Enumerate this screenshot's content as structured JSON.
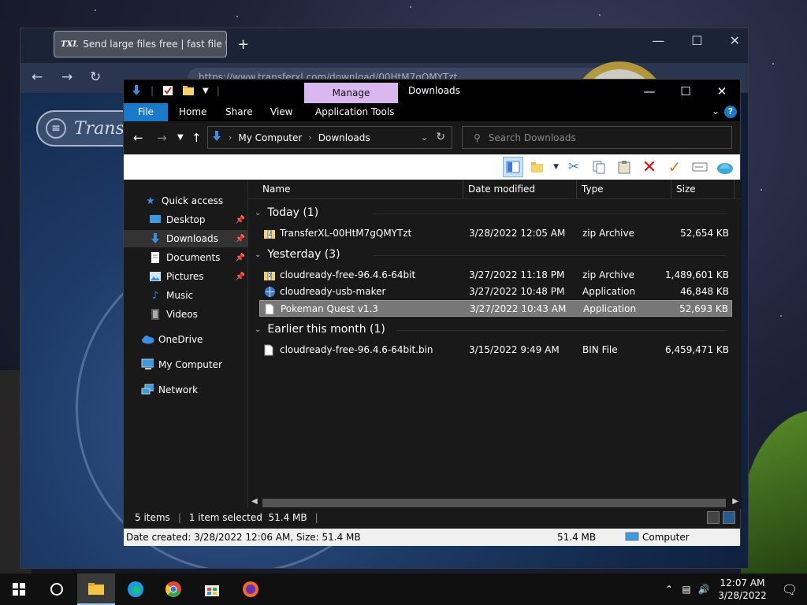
{
  "browser": {
    "tab_title": "Send large files free | fast file tra",
    "tab_favicon": "TXL",
    "url": "https://www.transferxl.com/download/00HtM7gQMYTzt",
    "logo_text": "Transfe"
  },
  "explorer": {
    "title": "Downloads",
    "context_tab": "Manage",
    "ribbon_tabs": [
      "File",
      "Home",
      "Share",
      "View",
      "Application Tools"
    ],
    "breadcrumb": [
      "My Computer",
      "Downloads"
    ],
    "search_placeholder": "Search Downloads",
    "columns": [
      "Name",
      "Date modified",
      "Type",
      "Size"
    ],
    "nav": {
      "quick_access": "Quick access",
      "desktop": "Desktop",
      "downloads": "Downloads",
      "documents": "Documents",
      "pictures": "Pictures",
      "music": "Music",
      "videos": "Videos",
      "onedrive": "OneDrive",
      "my_computer": "My Computer",
      "network": "Network"
    },
    "groups": [
      {
        "label": "Today (1)"
      },
      {
        "label": "Yesterday (3)"
      },
      {
        "label": "Earlier this month (1)"
      }
    ],
    "files": [
      {
        "name": "TransferXL-00HtM7gQMYTzt",
        "date": "3/28/2022 12:05 AM",
        "type": "zip Archive",
        "size": "52,654 KB"
      },
      {
        "name": "cloudready-free-96.4.6-64bit",
        "date": "3/27/2022 11:18 PM",
        "type": "zip Archive",
        "size": "1,489,601 KB"
      },
      {
        "name": "cloudready-usb-maker",
        "date": "3/27/2022 10:48 PM",
        "type": "Application",
        "size": "46,848 KB"
      },
      {
        "name": "Pokeman Quest v1.3",
        "date": "3/27/2022 10:43 AM",
        "type": "Application",
        "size": "52,693 KB"
      },
      {
        "name": "cloudready-free-96.4.6-64bit.bin",
        "date": "3/15/2022 9:49 AM",
        "type": "BIN File",
        "size": "6,459,471 KB"
      }
    ],
    "status": {
      "items": "5 items",
      "selected": "1 item selected  51.4 MB"
    },
    "details": {
      "info": "Date created: 3/28/2022 12:06 AM, Size: 51.4 MB",
      "size": "51.4 MB",
      "location": "Computer"
    }
  },
  "taskbar": {
    "time": "12:07 AM",
    "date": "3/28/2022"
  },
  "colors": {
    "file_tab": "#1979ca",
    "manage_tab": "#d9b8f0",
    "explorer_bg": "#191919",
    "selected_row": "#777777"
  }
}
